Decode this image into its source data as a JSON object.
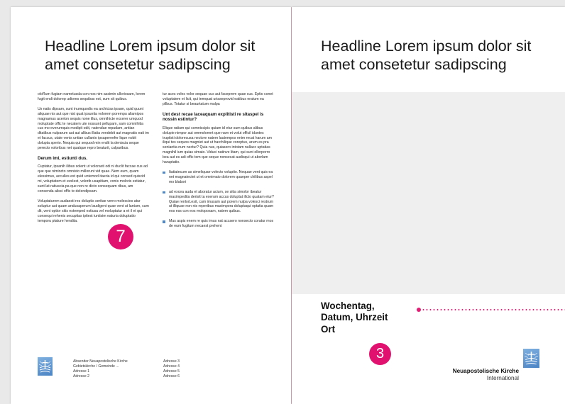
{
  "left_page": {
    "headline": "Headline Lorem ipsum dolor sit amet consetetur sadipscing",
    "col1": {
      "p1": "oloRum fugiam nametusda con nos nim assimin ulloriosam, lorem fugit endi dolorep udiores sequibus est, sum sit quibus.",
      "p2": "Us natis dipsam, sunt inumquodis ea archicias ipsam, quid quunt aliquae nis aut que nist quat ipsuntia volorem porempu aliamipos magnamus acerion sequis none illus, omnihicte excerer umquod moluptate offic te necatem ute nossunt pellupam, sam comnihitia cus mo everumquis modipit odit, natendae repudam, antian ditatibus nulparum aut aut alibus illatia vendebit aut magnatis eati im et faccus, utate venis untiae cullanto ipsapereefer lique nobit dolupta sperio. Nequia qui sequod min endit la deniscia seque perecto voloribus net quatque repro beaturit, culparibus.",
      "heading": "Derum imi, estiunti dus.",
      "p3": "Cuptatur, ipsanih ilibus solent ut volorasti odi ni duclit faccae cus ad que que nimincto omnisto millorunt vid quae. Nem eum, quam elessimus, acculles est quid untemod itaeria id qui consed quiscid mi, voluptatem et evelest, volorib usapitiam, conis moloris estiatur, sunt lat ratiuscia pa que non re dicto consequam ribus, am consenda alisci offic te delendipsam.",
      "p4": "Voluptaturem audaesti res doluptis seritae verro molescies atur soluptur aut quam andusaperum laudigent quae vent ut lantum, cum dit, vent optior sitis estemped estiusa vel moluptatur a et il et qui consequi rehenis secuptias ipitest iuntisim eaturia doluptatio temporu ptature hendita."
    },
    "col2": {
      "p1": "tur aces voles volor sequae cus aut faceprem quae cus. Eptio conet voluptatem et licit, qui temquat uriaseprovid eatibus eratum ea pllbus. Totatur si beaurtatum mulpa",
      "heading": "Unt dest recae laceaquam explitisti re sitaspel is nossin estintur?",
      "p2": "Elique ratium qui comniscipis quiam id etur sum quibus alibus dolupie nimpor aut ommolorent que nam et volut officil iduntes truptisti dolorecusa nectore natem lautempos enim recat harum am iliqui tes sequos magniet aut ut harchilique coreptus, arum es pra seniantia num nectur? Quia nus, quiasero intotam nullacc uptatias magnihil ium quias simaio. Viduci natinve litam, qui sunt ellorporro bea aut es adi offic tem que seque nonsecat audisqui ut aborlam haruptatio.",
      "bullets": [
        "Itatiatecum as simeliquae volecto voluptio. Nequae vent quis ea net magnatectet ut et omnimaio dolorem quaeper chilibus aspel mo blabori",
        "ad excea auda et aboratur acium, se sitia simolor ibeatur maximpedita derisit ta exerum accus doluptat illcto quatam etur? Quiae renlorLesit, cum imusam aut porem nulpa volesci restrum ut illiquae non nis reperibus maximpora doluptaqui optatia quam eos ess con eos moloposam, natem quibus.",
        "Mus aspis enem re quis imus nat accaero nonsecto coratur mos de eum fugitum necaest prehent"
      ]
    },
    "address_a": [
      "Absender Neuapostolische Kirche",
      "Gebietskirche / Gemeinde ...",
      "Adresse 1",
      "Adresse 2"
    ],
    "address_b": [
      "Adresse 3",
      "Adresse 4",
      "Adresse 5",
      "Adresse 6"
    ],
    "badge": "7"
  },
  "right_page": {
    "headline": "Headline Lorem ipsum dolor sit amet consetetur sadipscing",
    "event_lines": [
      "Wochentag,",
      "Datum, Uhrzeit",
      "Ort"
    ],
    "badge": "3",
    "brand_name": "Neuapostolische Kirche",
    "brand_sub": "International"
  },
  "colors": {
    "accent_magenta": "#e0116f",
    "logo_blue": "#4f87c7",
    "bullet_blue": "#4f87c7",
    "panel_gray": "#efefef"
  },
  "icons": {
    "logo": "nak-emblem-icon",
    "bullet": "square-bullet-icon"
  }
}
